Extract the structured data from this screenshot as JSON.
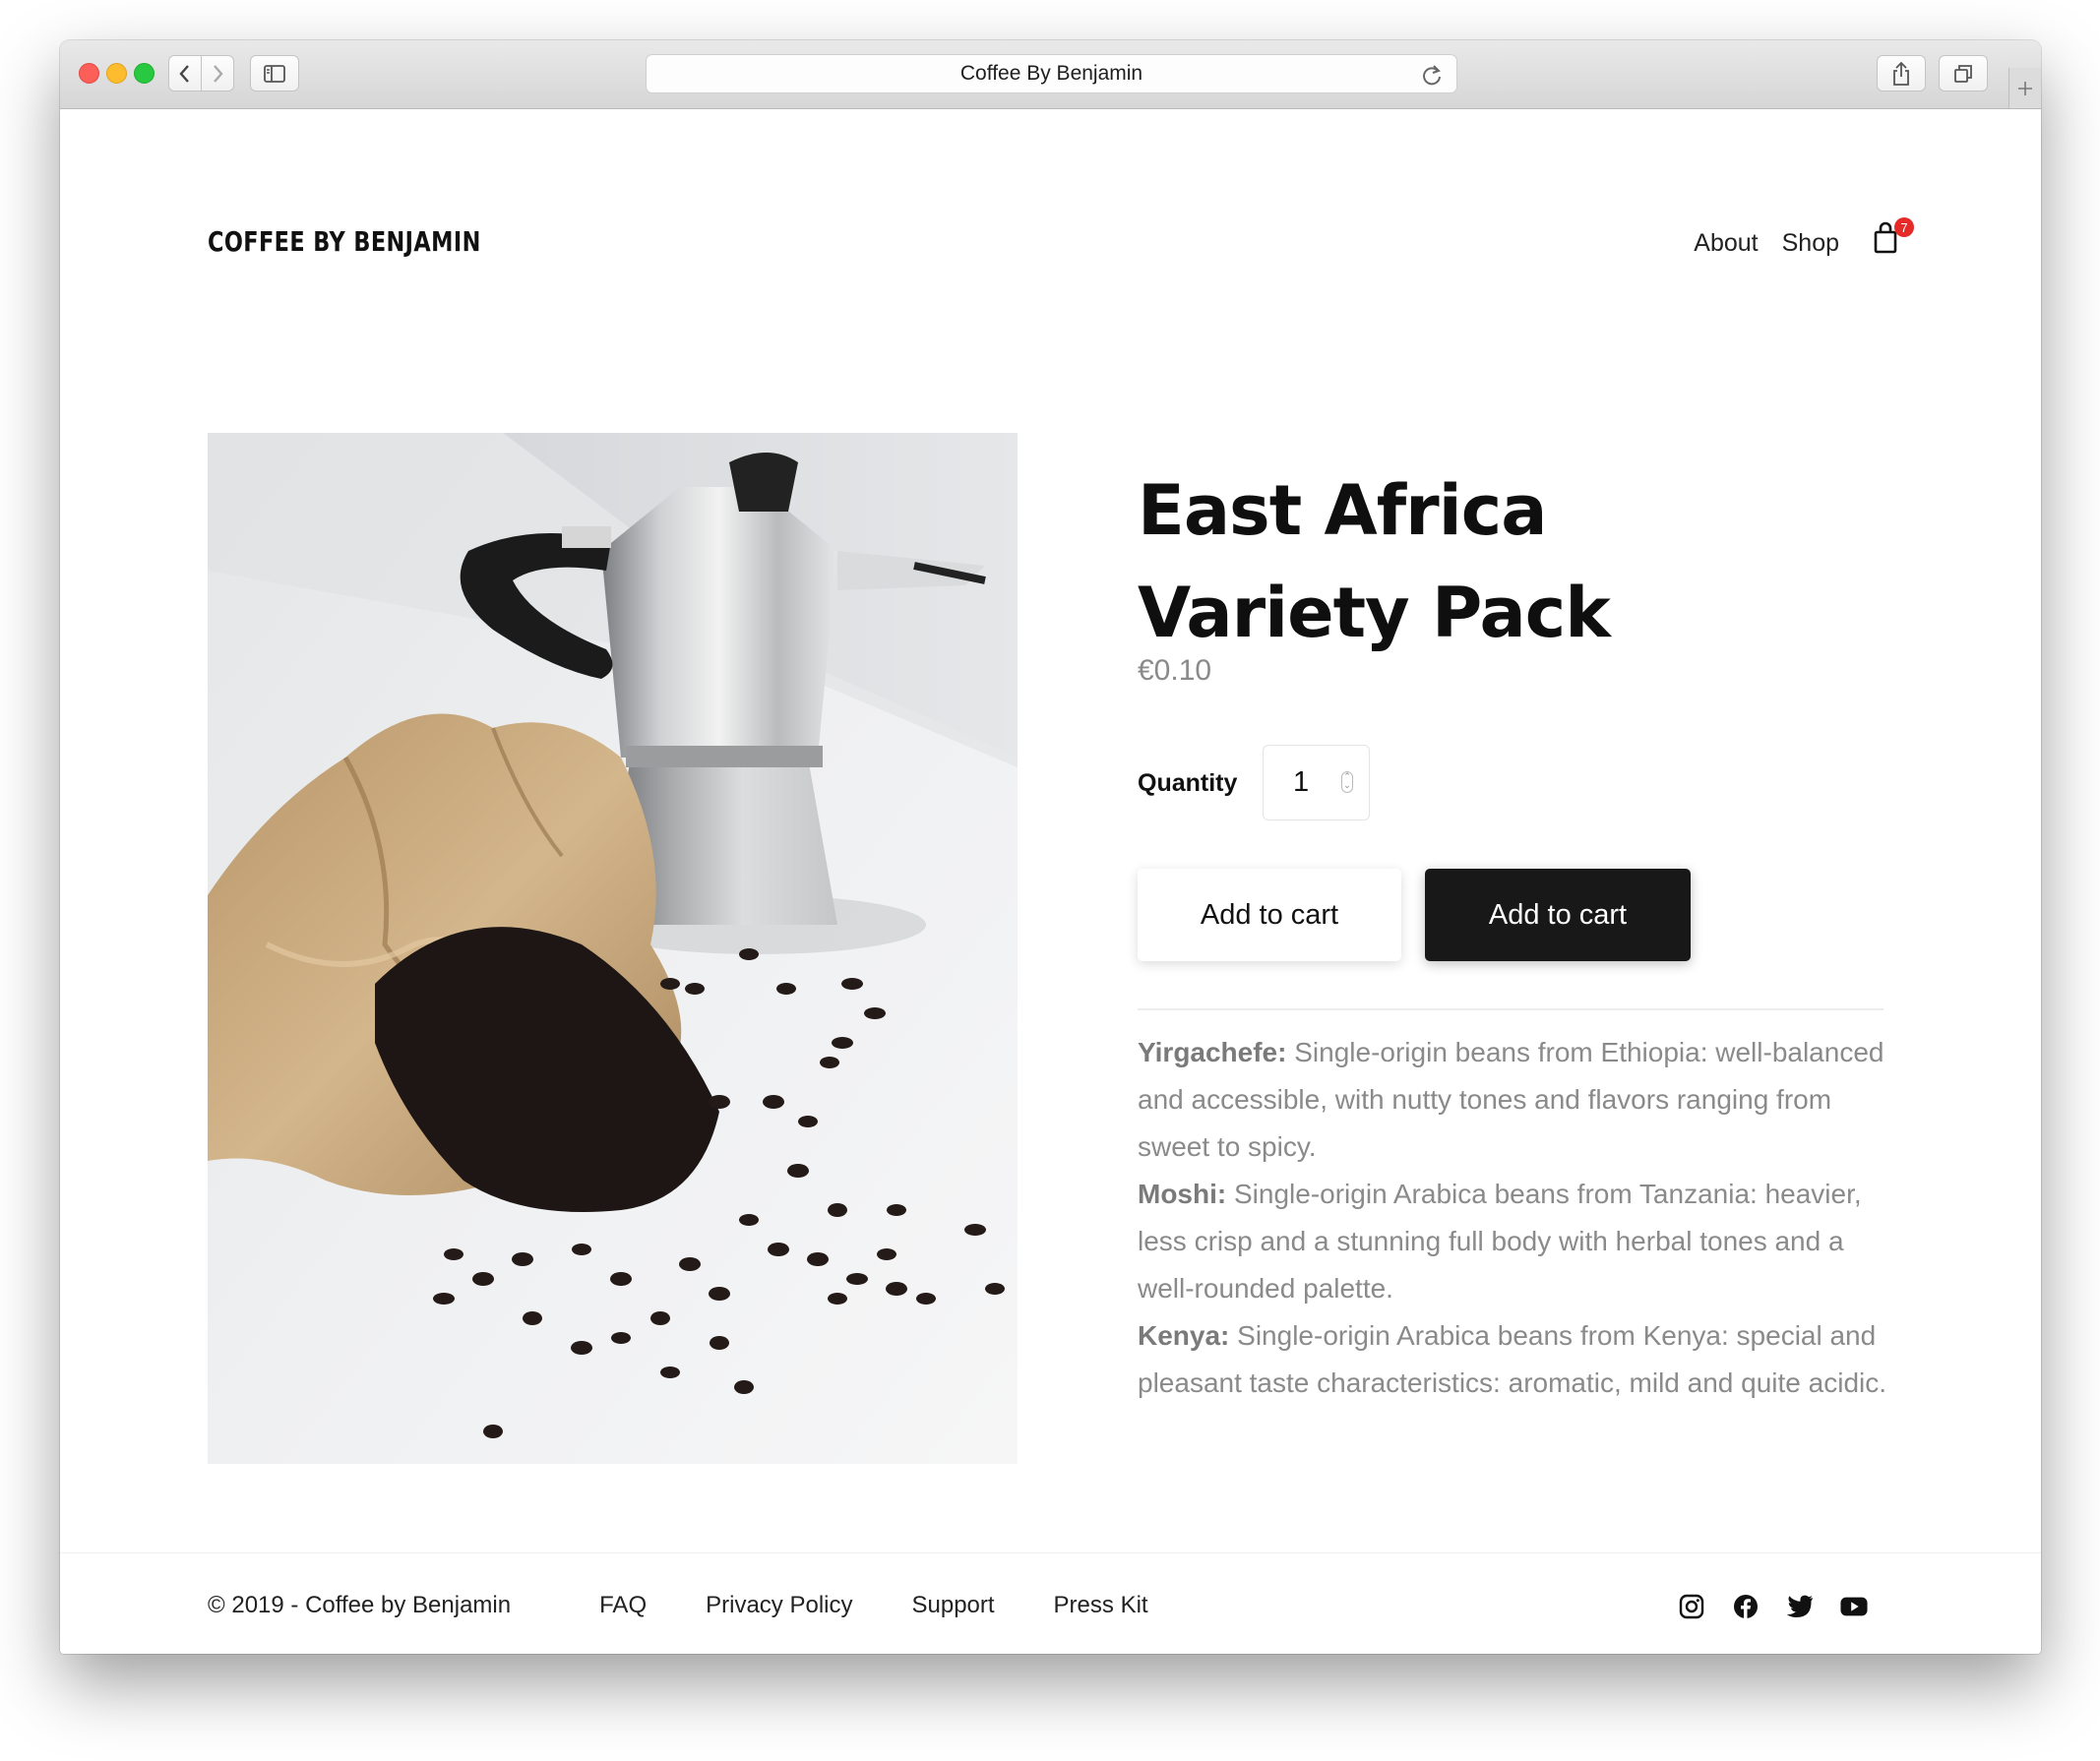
{
  "browser": {
    "address_text": "Coffee By Benjamin"
  },
  "site": {
    "brand": "COFFEE BY BENJAMIN",
    "nav": {
      "about": "About",
      "shop": "Shop"
    },
    "cart_count": "7"
  },
  "product": {
    "image_alt": "Moka pot with paper bag of coffee beans on marble",
    "title": "East Africa Variety Pack",
    "price": "€0.10",
    "quantity_label": "Quantity",
    "quantity_value": "1",
    "add_to_cart_label": "Add to cart",
    "add_to_cart_primary_label": "Add to cart",
    "description": [
      {
        "name": "Yirgachefe:",
        "text": " Single-origin beans from Ethiopia: well-balanced and accessible, with nutty tones and flavors ranging from sweet to spicy."
      },
      {
        "name": "Moshi:",
        "text": " Single-origin Arabica beans from Tanzania: heavier, less crisp and a stunning full body with herbal tones and a well-rounded palette."
      },
      {
        "name": "Kenya:",
        "text": " Single-origin  Arabica beans from Kenya: special and pleasant taste characteristics: aromatic, mild and quite acidic."
      }
    ]
  },
  "footer": {
    "copyright": "© 2019 - Coffee by Benjamin",
    "links": [
      "FAQ",
      "Privacy Policy",
      "Support",
      "Press Kit"
    ],
    "social_icons": [
      "instagram-icon",
      "facebook-icon",
      "twitter-icon",
      "youtube-icon"
    ]
  },
  "colors": {
    "primary_button_bg": "#181818",
    "cart_badge": "#e52a27",
    "muted_text": "#8a8a8a"
  }
}
